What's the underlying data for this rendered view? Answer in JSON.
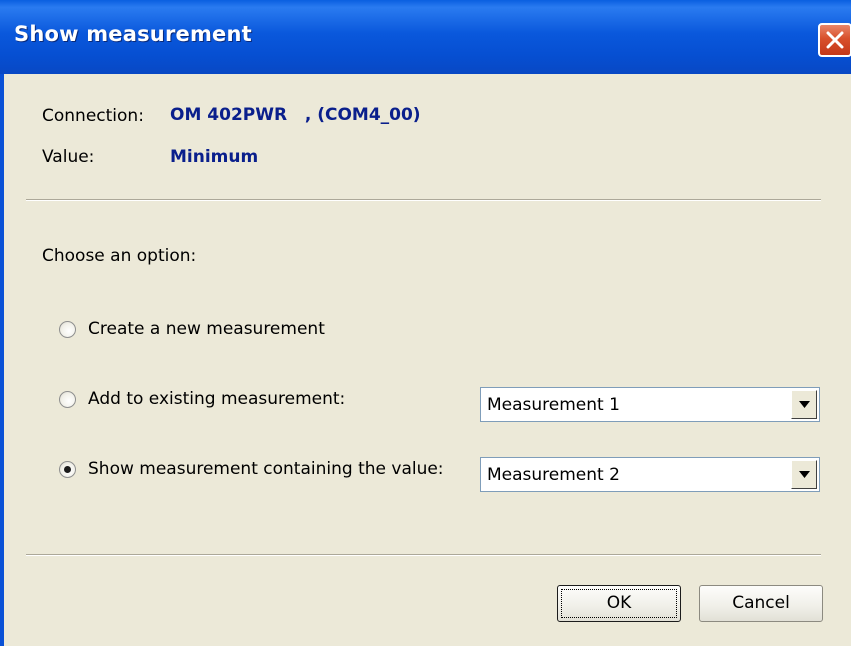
{
  "window": {
    "title": "Show measurement"
  },
  "info": {
    "connection_label": "Connection:",
    "connection_value": "OM 402PWR   , (COM4_00)",
    "value_label": "Value:",
    "value_value": "Minimum"
  },
  "options": {
    "prompt": "Choose an option:",
    "items": [
      {
        "label": "Create a new measurement",
        "selected": false
      },
      {
        "label": "Add to existing measurement:",
        "selected": false,
        "dropdown_value": "Measurement 1"
      },
      {
        "label": "Show measurement containing the value:",
        "selected": true,
        "dropdown_value": "Measurement 2"
      }
    ]
  },
  "buttons": {
    "ok": "OK",
    "cancel": "Cancel"
  },
  "icons": {
    "close": "close-icon",
    "dropdown": "chevron-down-icon"
  },
  "colors": {
    "title_bar": "#0a58dc",
    "value_text": "#0a1f8c",
    "close_button": "#d8502b",
    "background": "#ece9d8"
  }
}
